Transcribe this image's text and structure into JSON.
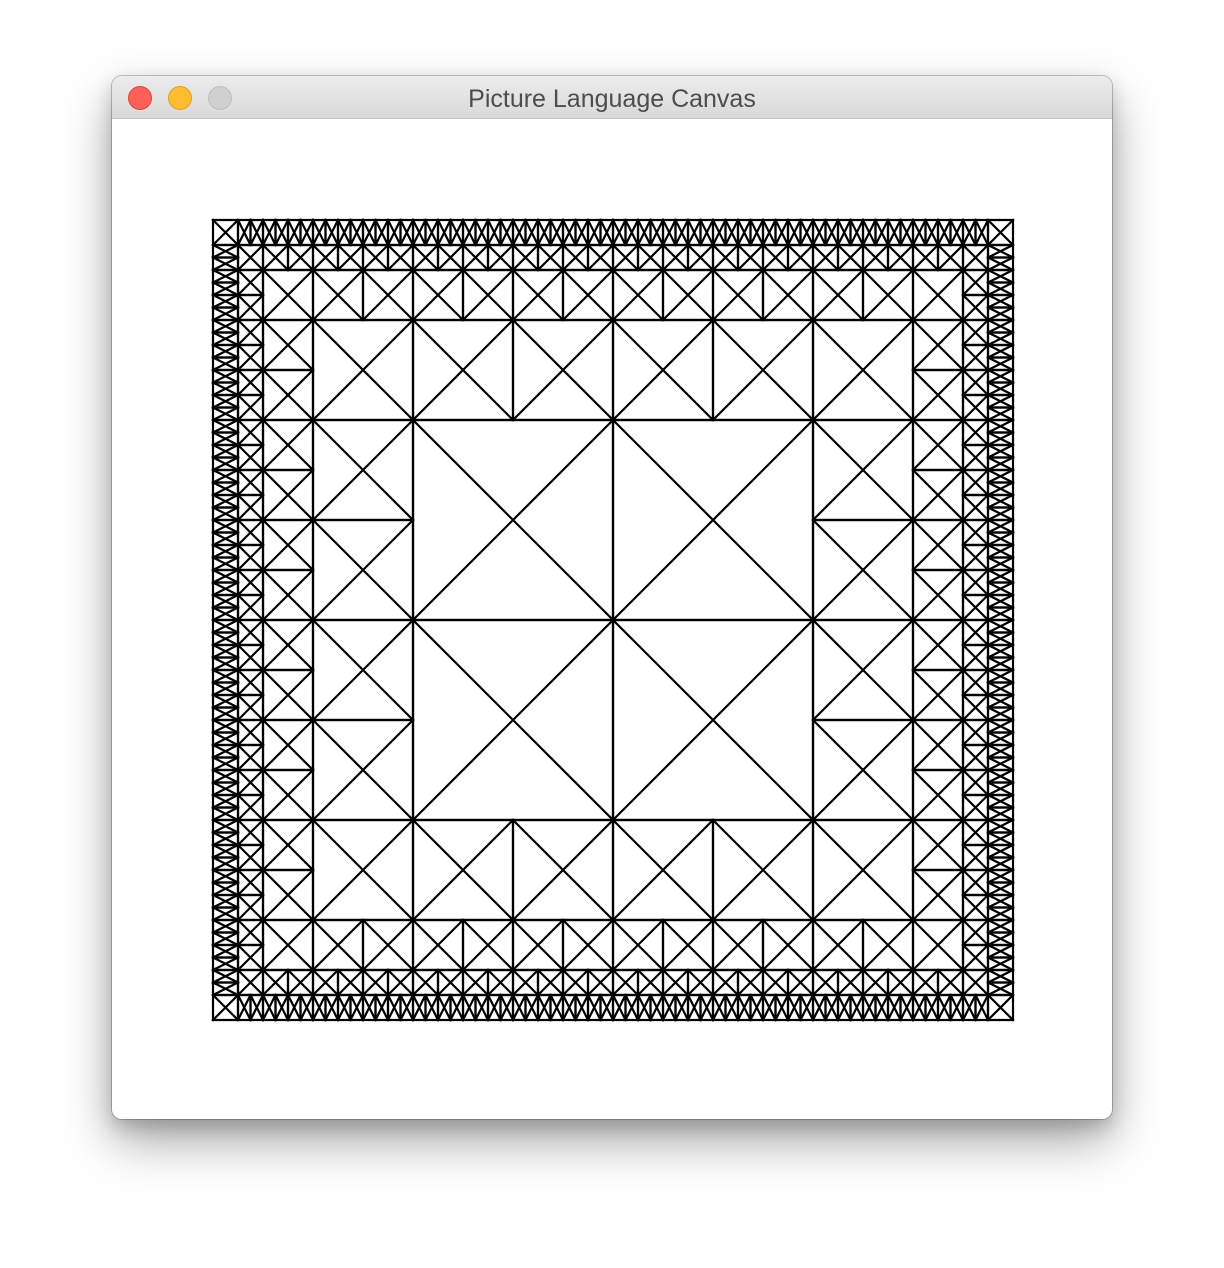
{
  "window": {
    "title": "Picture Language Canvas"
  },
  "colors": {
    "close": "#fe5f57",
    "close_border": "#e0443e",
    "minimize": "#febc2e",
    "minimize_border": "#dea123",
    "zoom_disabled": "#d0d0d0",
    "zoom_border": "#bdbdbd",
    "stroke": "#000000",
    "canvas_background": "#ffffff"
  },
  "canvas": {
    "pattern": "square-limit",
    "depth": 4,
    "tile": "x-in-square"
  }
}
